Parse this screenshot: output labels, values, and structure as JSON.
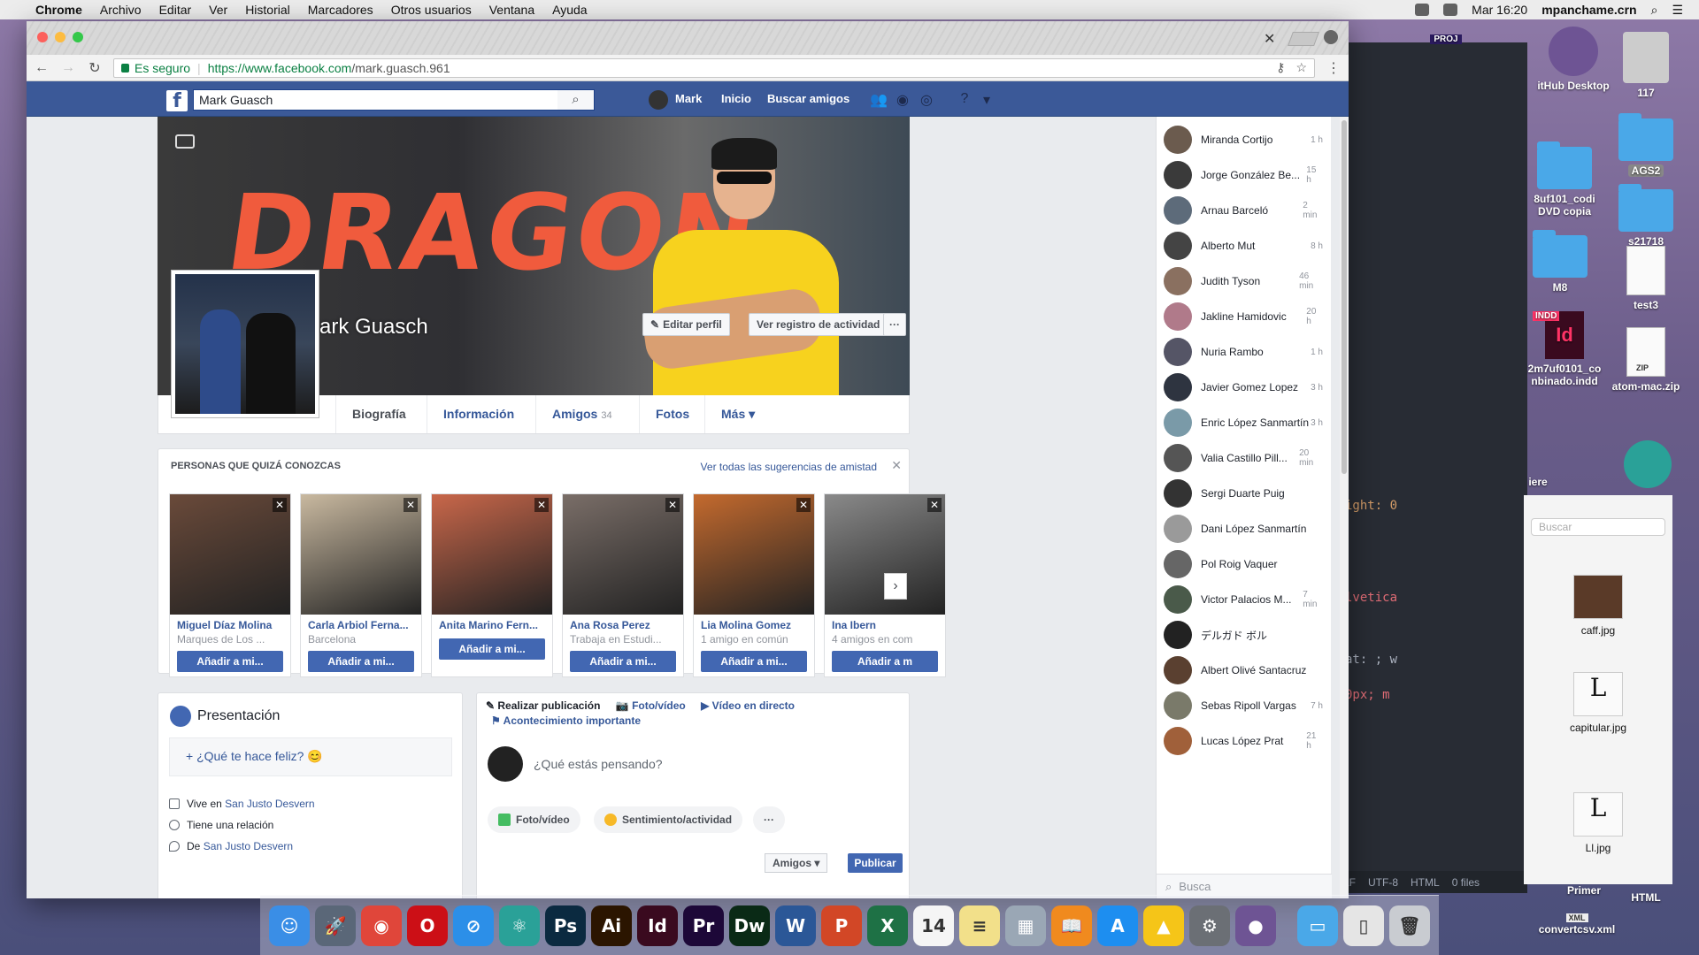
{
  "menubar": {
    "app": "Chrome",
    "items": [
      "Archivo",
      "Editar",
      "Ver",
      "Historial",
      "Marcadores",
      "Otros usuarios",
      "Ventana",
      "Ayuda"
    ],
    "clock": "Mar 16:20",
    "user": "mpanchame.crn"
  },
  "browser": {
    "secure_label": "Es seguro",
    "url_host": "https://www.facebook.com",
    "url_path": "/mark.guasch.961"
  },
  "facebook": {
    "logo": "f",
    "search_value": "Mark Guasch",
    "nav": {
      "user": "Mark",
      "home": "Inicio",
      "find_friends": "Buscar amigos"
    },
    "cover": {
      "brand_text": "DRAGON",
      "name": "Mark Guasch",
      "edit_profile": "Editar perfil",
      "activity_log": "Ver registro de actividad",
      "more": "···"
    },
    "tabs": [
      {
        "label": "Biografía"
      },
      {
        "label": "Información"
      },
      {
        "label": "Amigos",
        "count": "34"
      },
      {
        "label": "Fotos"
      },
      {
        "label": "Más ▾"
      }
    ],
    "pymk": {
      "title": "PERSONAS QUE QUIZÁ CONOZCAS",
      "see_all": "Ver todas las sugerencias de amistad",
      "close": "✕",
      "people": [
        {
          "name": "Miguel Díaz Molina",
          "info": "Marques de Los ...",
          "action": "Añadir a mi...",
          "color": "#6a4a3a"
        },
        {
          "name": "Carla Arbiol Ferna...",
          "info": "Barcelona",
          "action": "Añadir a mi...",
          "color": "#c9b9a0"
        },
        {
          "name": "Anita Marino Fern...",
          "info": "",
          "action": "Añadir a mi...",
          "color": "#c9674a"
        },
        {
          "name": "Ana Rosa Perez",
          "info": "Trabaja en Estudi...",
          "action": "Añadir a mi...",
          "color": "#7a6e68"
        },
        {
          "name": "Lia Molina Gomez",
          "info": "1 amigo en común",
          "action": "Añadir a mi...",
          "color": "#c46a2e"
        },
        {
          "name": "Ina Ibern",
          "info": "4 amigos en com",
          "action": "Añadir a m",
          "color": "#8a8a8a"
        }
      ]
    },
    "intro": {
      "title": "Presentación",
      "happy_prompt": "+ ¿Qué te hace feliz? 😊",
      "lives_prefix": "Vive en ",
      "lives_place": "San Justo Desvern",
      "relationship": "Tiene una relación",
      "from_prefix": "De ",
      "from_place": "San Justo Desvern"
    },
    "composer": {
      "make_post": "Realizar publicación",
      "photo_video": "Foto/vídeo",
      "live_video": "Vídeo en directo",
      "life_event": "Acontecimiento importante",
      "placeholder": "¿Qué estás pensando?",
      "pill_photo": "Foto/vídeo",
      "pill_feeling": "Sentimiento/actividad",
      "pill_more": "···",
      "audience": "Amigos ▾",
      "publish": "Publicar"
    },
    "chat": {
      "search_placeholder": "Busca",
      "contacts": [
        {
          "name": "Miranda Cortijo",
          "time": "1 h"
        },
        {
          "name": "Jorge González Be...",
          "time": "15 h"
        },
        {
          "name": "Arnau Barceló",
          "time": "2 min"
        },
        {
          "name": "Alberto Mut",
          "time": "8 h"
        },
        {
          "name": "Judith Tyson",
          "time": "46 min"
        },
        {
          "name": "Jakline Hamidovic",
          "time": "20 h"
        },
        {
          "name": "Nuria Rambo",
          "time": "1 h"
        },
        {
          "name": "Javier Gomez Lopez",
          "time": "3 h"
        },
        {
          "name": "Enric López Sanmartín",
          "time": "3 h"
        },
        {
          "name": "Valia Castillo Pill...",
          "time": "20 min"
        },
        {
          "name": "Sergi Duarte Puig",
          "time": ""
        },
        {
          "name": "Dani López Sanmartín",
          "time": ""
        },
        {
          "name": "Pol Roig Vaquer",
          "time": ""
        },
        {
          "name": "Victor Palacios M...",
          "time": "7 min"
        },
        {
          "name": "デルガド ボル",
          "time": ""
        },
        {
          "name": "Albert Olivé Santacruz",
          "time": ""
        },
        {
          "name": "Sebas Ripoll Vargas",
          "time": "7 h"
        },
        {
          "name": "Lucas López Prat",
          "time": "21 h"
        }
      ]
    }
  },
  "desktop": {
    "items": [
      "itHub Desktop",
      "117",
      "AGS2",
      "8uf101_codi",
      "DVD copia",
      "s21718",
      "M8",
      "test3",
      "INDD",
      "2m7uf0101_co",
      "nbinado.indd",
      "ZIP",
      "atom-mac.zip",
      "iere",
      "Primer",
      "HTML",
      "XML",
      "convertcsv.xml",
      "PROJ"
    ]
  },
  "finder": {
    "search_placeholder": "Buscar",
    "files": [
      "caff.jpg",
      "capitular.jpg",
      "Ll.jpg"
    ]
  },
  "editor": {
    "code": [
      "ight: 0",
      "lvetica",
      "at: ; w",
      "0px; m"
    ],
    "status": [
      "LF",
      "UTF-8",
      "HTML",
      "0 files"
    ]
  },
  "dock": {
    "apps": [
      {
        "label": "☺",
        "color": "#3a8ee6",
        "icon": "finder-icon"
      },
      {
        "label": "🚀",
        "color": "#5a6778",
        "icon": "launchpad-icon"
      },
      {
        "label": "◉",
        "color": "#e0463a",
        "icon": "chrome-icon"
      },
      {
        "label": "O",
        "color": "#cc0f16",
        "icon": "opera-icon"
      },
      {
        "label": "⊘",
        "color": "#2c8fe8",
        "icon": "safari-icon"
      },
      {
        "label": "⚛",
        "color": "#2aa198",
        "icon": "atom-icon"
      },
      {
        "label": "Ps",
        "color": "#0b2a40",
        "icon": "photoshop-icon"
      },
      {
        "label": "Ai",
        "color": "#2b1500",
        "icon": "illustrator-icon"
      },
      {
        "label": "Id",
        "color": "#3a0a1f",
        "icon": "indesign-icon"
      },
      {
        "label": "Pr",
        "color": "#1d0838",
        "icon": "premiere-icon"
      },
      {
        "label": "Dw",
        "color": "#0a2a16",
        "icon": "dreamweaver-icon"
      },
      {
        "label": "W",
        "color": "#2b5797",
        "icon": "word-icon"
      },
      {
        "label": "P",
        "color": "#d24726",
        "icon": "powerpoint-icon"
      },
      {
        "label": "X",
        "color": "#1e7145",
        "icon": "excel-icon"
      },
      {
        "label": "14",
        "color": "#f5f5f5",
        "icon": "calendar-icon"
      },
      {
        "label": "≡",
        "color": "#f2e08a",
        "icon": "notes-icon"
      },
      {
        "label": "▦",
        "color": "#9aa7b5",
        "icon": "preview-icon"
      },
      {
        "label": "📖",
        "color": "#f08a1e",
        "icon": "ibooks-icon"
      },
      {
        "label": "A",
        "color": "#1d8ef0",
        "icon": "appstore-icon"
      },
      {
        "label": "▲",
        "color": "#f5c518",
        "icon": "drive-icon"
      },
      {
        "label": "⚙",
        "color": "#6b6f75",
        "icon": "settings-icon"
      },
      {
        "label": "●",
        "color": "#6e5494",
        "icon": "github-icon"
      },
      {
        "label": "▭",
        "color": "#4aa8e8",
        "icon": "folder-icon"
      },
      {
        "label": "▯",
        "color": "#e5e5e5",
        "icon": "zip-icon"
      },
      {
        "label": "🗑",
        "color": "#c9ccd1",
        "icon": "trash-icon"
      }
    ]
  }
}
